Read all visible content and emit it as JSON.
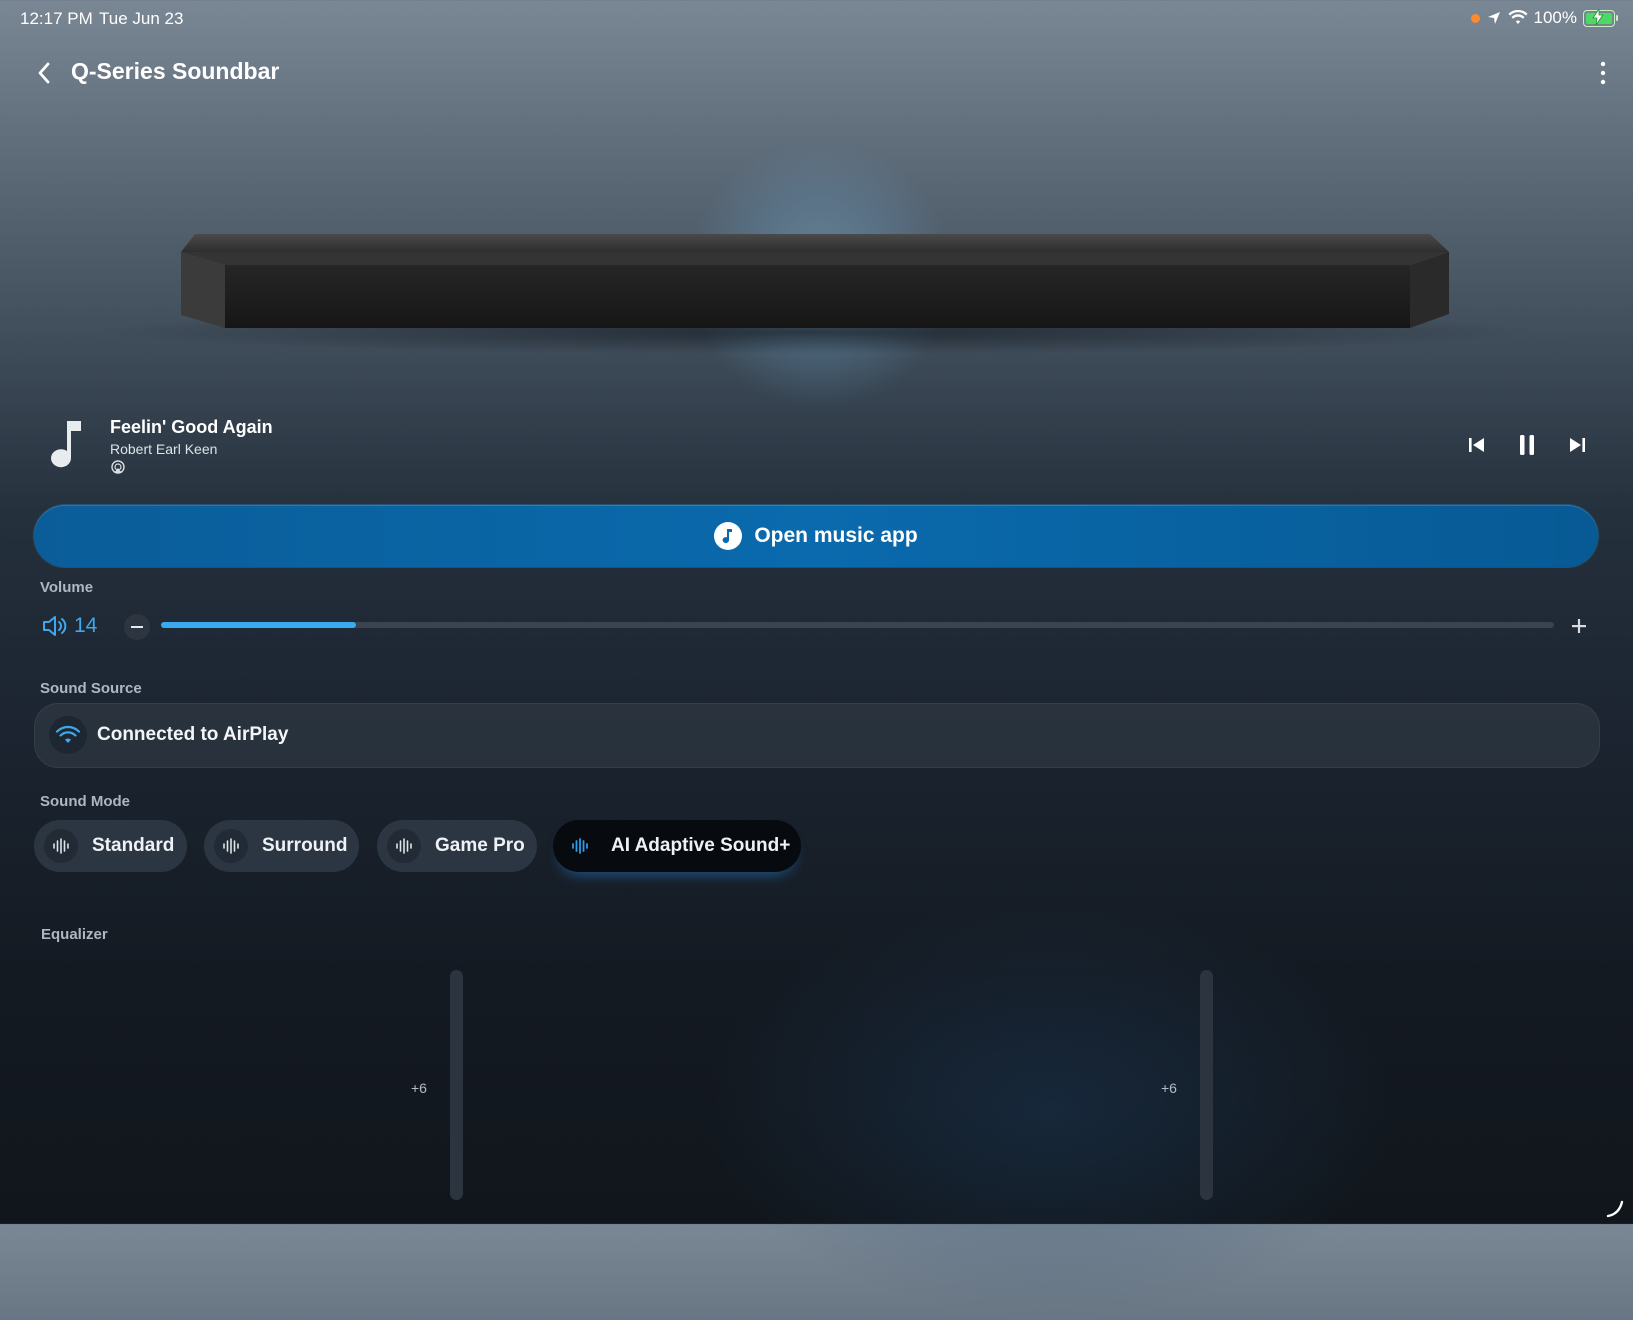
{
  "status_bar": {
    "time": "12:17 PM",
    "date": "Tue Jun 23",
    "battery_percent": "100%",
    "icons": [
      "orange-dot-indicator",
      "location-arrow-icon",
      "wifi-icon",
      "battery-charging-icon"
    ]
  },
  "header": {
    "title": "Q-Series Soundbar",
    "back_icon": "chevron-left-icon",
    "more_icon": "vertical-ellipsis-icon"
  },
  "now_playing": {
    "title": "Feelin' Good Again",
    "artist": "Robert Earl Keen",
    "art_icon": "music-note-icon",
    "source_icon": "airplay-icon",
    "controls": [
      "previous-track-icon",
      "pause-icon",
      "next-track-icon"
    ]
  },
  "open_music": {
    "label": "Open music app",
    "icon": "music-note-circle-icon"
  },
  "volume": {
    "label": "Volume",
    "value": "14",
    "level": 0.14,
    "accent": "#3ba9ef"
  },
  "sound_source": {
    "label": "Sound Source",
    "status": "Connected to AirPlay",
    "icon": "wifi-icon"
  },
  "sound_mode": {
    "label": "Sound Mode",
    "modes": [
      {
        "label": "Standard",
        "active": false
      },
      {
        "label": "Surround",
        "active": false
      },
      {
        "label": "Game Pro",
        "active": false
      },
      {
        "label": "AI Adaptive Sound+",
        "active": true
      }
    ]
  },
  "equalizer": {
    "label": "Equalizer",
    "sliders": [
      {
        "top_tick": "+6"
      },
      {
        "top_tick": "+6"
      }
    ]
  }
}
